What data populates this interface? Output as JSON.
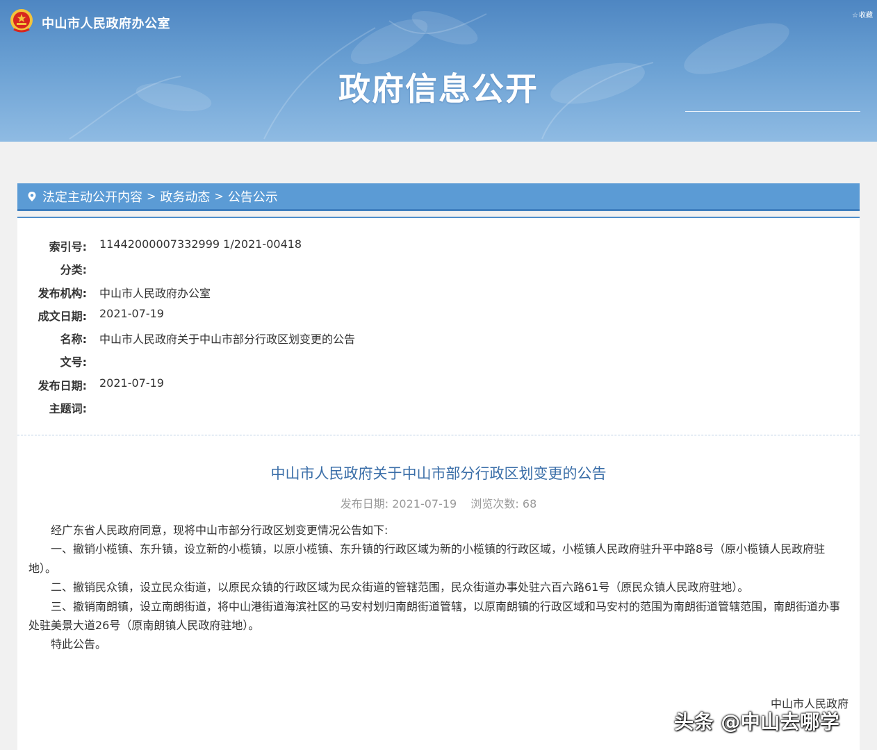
{
  "header": {
    "org_name": "中山市人民政府办公室",
    "favorite_label": "收藏",
    "banner_title": "政府信息公开"
  },
  "breadcrumb": {
    "items": [
      "法定主动公开内容",
      "政务动态",
      "公告公示"
    ]
  },
  "meta": {
    "rows": [
      {
        "label": "索引号:",
        "value": "11442000007332999 1/2021-00418"
      },
      {
        "label": "分类:",
        "value": ""
      },
      {
        "label": "发布机构:",
        "value": "中山市人民政府办公室"
      },
      {
        "label": "成文日期:",
        "value": "2021-07-19"
      },
      {
        "label": "名称:",
        "value": "中山市人民政府关于中山市部分行政区划变更的公告"
      },
      {
        "label": "文号:",
        "value": ""
      },
      {
        "label": "发布日期:",
        "value": "2021-07-19"
      },
      {
        "label": "主题词:",
        "value": ""
      }
    ]
  },
  "document": {
    "title": "中山市人民政府关于中山市部分行政区划变更的公告",
    "publish_date_label": "发布日期:",
    "publish_date": "2021-07-19",
    "views_label": "浏览次数:",
    "views": "68",
    "paragraphs": [
      "经广东省人民政府同意，现将中山市部分行政区划变更情况公告如下:",
      "一、撤销小榄镇、东升镇，设立新的小榄镇，以原小榄镇、东升镇的行政区域为新的小榄镇的行政区域，小榄镇人民政府驻升平中路8号（原小榄镇人民政府驻地）。",
      "二、撤销民众镇，设立民众街道，以原民众镇的行政区域为民众街道的管辖范围，民众街道办事处驻六百六路61号（原民众镇人民政府驻地）。",
      "三、撤销南朗镇，设立南朗街道，将中山港街道海滨社区的马安村划归南朗街道管辖，以原南朗镇的行政区域和马安村的范围为南朗街道管辖范围，南朗街道办事处驻美景大道26号（原南朗镇人民政府驻地）。",
      "特此公告。"
    ],
    "signature": "中山市人民政府"
  },
  "watermark": "头条 @中山去哪学",
  "colors": {
    "banner_top": "#4e86c2",
    "breadcrumb_bar": "#5b9bd5",
    "doc_title": "#3a6ea8",
    "emblem_red": "#d7261e",
    "emblem_gold": "#f3c33b"
  },
  "icons": [
    "national-emblem-icon",
    "star-icon",
    "location-pin-icon",
    "chevron-right-icon"
  ]
}
